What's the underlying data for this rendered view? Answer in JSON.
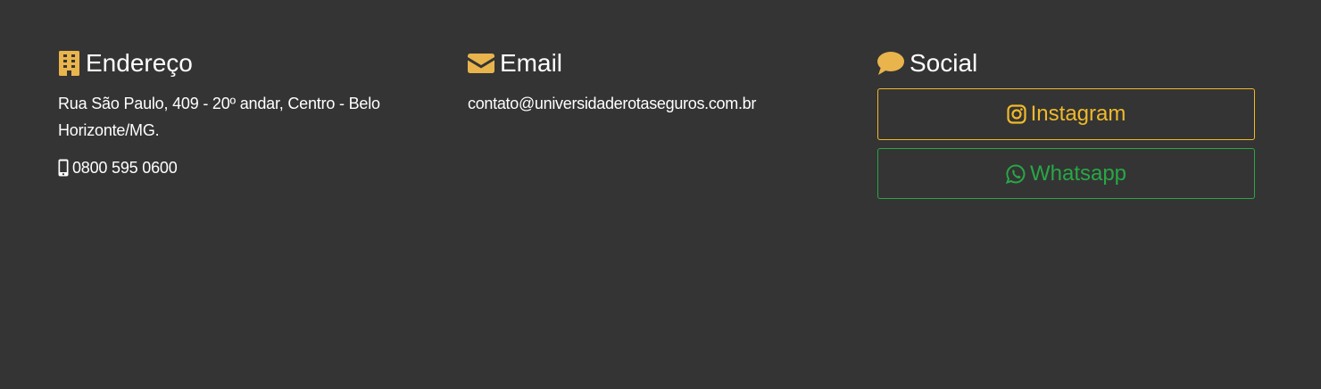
{
  "colors": {
    "background": "#343434",
    "accent": "#e9b44c",
    "instagram": "#f0b92a",
    "whatsapp": "#28a745",
    "text": "#ffffff"
  },
  "address": {
    "icon": "building-icon",
    "title": "Endereço",
    "text": "Rua São Paulo, 409 - 20º andar, Centro - Belo Horizonte/MG.",
    "phone_icon": "mobile-phone-icon",
    "phone": "0800 595 0600"
  },
  "email": {
    "icon": "envelope-icon",
    "title": "Email",
    "address": "contato@universidaderotaseguros.com.br"
  },
  "social": {
    "icon": "comment-icon",
    "title": "Social",
    "instagram": {
      "icon": "instagram-icon",
      "label": "Instagram"
    },
    "whatsapp": {
      "icon": "whatsapp-icon",
      "label": "Whatsapp"
    }
  }
}
